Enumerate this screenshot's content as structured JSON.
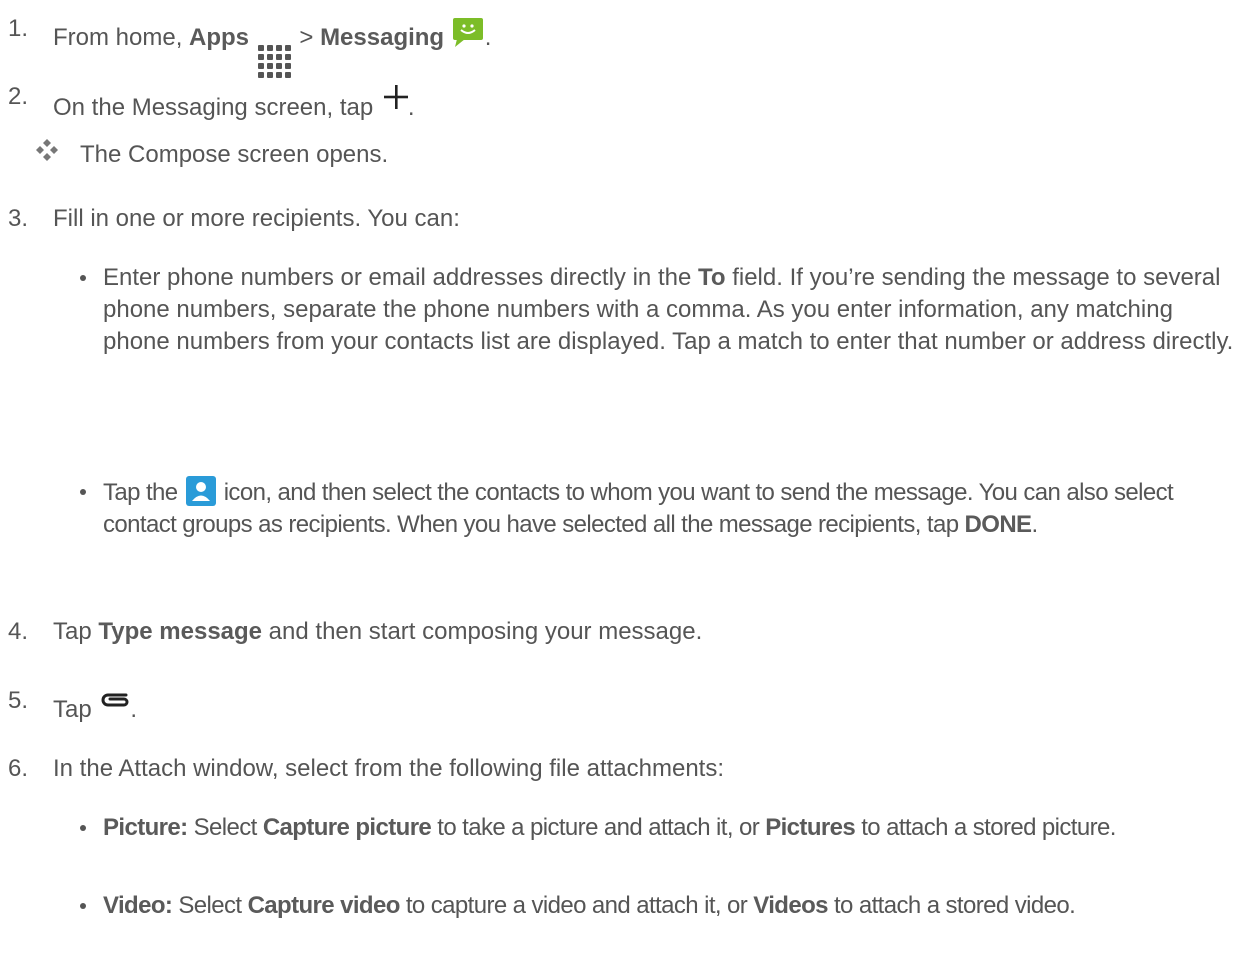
{
  "steps": [
    {
      "num": "1.",
      "prefix": "From home, ",
      "b1": "Apps",
      "sep": " > ",
      "b2": "Messaging",
      "suffix": "."
    },
    {
      "num": "2.",
      "text": "On the Messaging screen, tap",
      "suffix": "."
    },
    {
      "note": "The Compose screen opens."
    },
    {
      "num": "3.",
      "text": "Fill in one or more recipients. You can:"
    },
    {
      "num": "4.",
      "prefix": "Tap ",
      "bold": "Type message",
      "suffix": " and then start composing your message."
    },
    {
      "num": "5.",
      "prefix": "Tap",
      "suffix": "."
    },
    {
      "num": "6.",
      "text": "In the Attach window, select from the following file attachments:"
    }
  ],
  "step3_bullets": {
    "b1": {
      "pre": "Enter phone numbers or email addresses directly in the ",
      "bold": "To",
      "post": " field. If you’re sending the message to several phone numbers, separate the phone numbers with a comma. As you enter information, any matching phone numbers from your contacts list are displayed. Tap a match to enter that number or address directly."
    },
    "b2": {
      "pre": "Tap the",
      "post": "icon, and then select the contacts to whom you want to send the message. You can also select contact groups as recipients. When you have selected all the message recipients, tap ",
      "bold": "DONE",
      "end": "."
    }
  },
  "step6_bullets": {
    "picture": {
      "label": "Picture:",
      "t1": " Select ",
      "b1": "Capture picture",
      "t2": " to take a picture and attach it, or ",
      "b2": "Pictures",
      "t3": " to attach a stored picture."
    },
    "video": {
      "label": "Video:",
      "t1": " Select ",
      "b1": "Capture video",
      "t2": " to capture a video and attach it, or ",
      "b2": "Videos",
      "t3": " to attach a stored video."
    }
  }
}
